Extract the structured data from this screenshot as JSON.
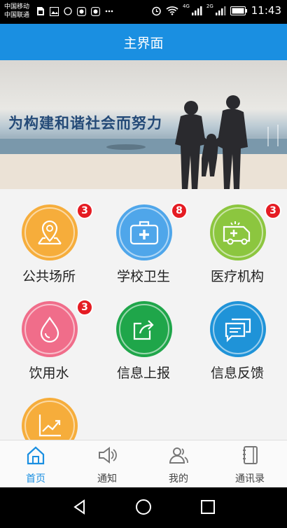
{
  "status_bar": {
    "carrier_1": "中国移动",
    "carrier_2": "中国联通",
    "network_1": "4G",
    "network_2": "2G",
    "time": "11:43",
    "left_icons": [
      "sim-card-icon",
      "image-icon",
      "circle-icon",
      "app-notification-icon",
      "app-notification-icon",
      "more-icon"
    ],
    "right_icons": [
      "alarm-icon",
      "wifi-icon",
      "signal-icon",
      "signal-icon",
      "battery-icon"
    ]
  },
  "header": {
    "title": "主界面"
  },
  "banner": {
    "slogan": "为构建和谐社会而努力"
  },
  "tiles": [
    {
      "label": "公共场所",
      "badge": "3",
      "icon": "map-pin-icon",
      "color": "#f6ad3b"
    },
    {
      "label": "学校卫生",
      "badge": "8",
      "icon": "first-aid-kit-icon",
      "color": "#4fa6ea"
    },
    {
      "label": "医疗机构",
      "badge": "3",
      "icon": "ambulance-icon",
      "color": "#8cc63f"
    },
    {
      "label": "饮用水",
      "badge": "3",
      "icon": "water-drop-icon",
      "color": "#f06d8a"
    },
    {
      "label": "信息上报",
      "badge": "",
      "icon": "share-report-icon",
      "color": "#1fa64a"
    },
    {
      "label": "信息反馈",
      "badge": "",
      "icon": "feedback-chat-icon",
      "color": "#1f93d8"
    },
    {
      "label": "",
      "badge": "",
      "icon": "chart-trend-icon",
      "color": "#f6ad3b"
    }
  ],
  "tabbar": {
    "active_color": "#1a8fe1",
    "tabs": [
      {
        "label": "首页",
        "icon": "home-icon",
        "active": true
      },
      {
        "label": "通知",
        "icon": "speaker-icon",
        "active": false
      },
      {
        "label": "我的",
        "icon": "user-icon",
        "active": false
      },
      {
        "label": "通讯录",
        "icon": "contacts-icon",
        "active": false
      }
    ]
  },
  "navbar": {
    "buttons": [
      "back-icon",
      "home-circle-icon",
      "recent-apps-icon"
    ]
  }
}
